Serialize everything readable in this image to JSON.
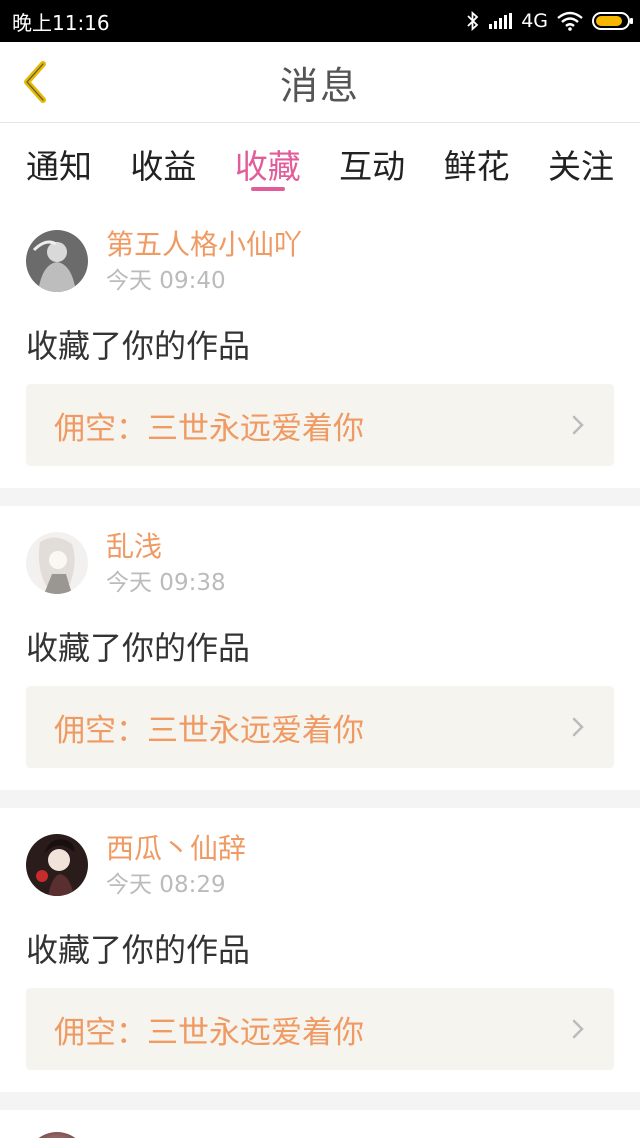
{
  "status_bar": {
    "time": "晚上11:16",
    "network": "4G",
    "battery_percent": 85
  },
  "header": {
    "title": "消息"
  },
  "tabs": [
    {
      "label": "通知",
      "active": false
    },
    {
      "label": "收益",
      "active": false
    },
    {
      "label": "收藏",
      "active": true
    },
    {
      "label": "互动",
      "active": false
    },
    {
      "label": "鲜花",
      "active": false
    },
    {
      "label": "关注",
      "active": false
    }
  ],
  "messages": [
    {
      "username": "第五人格小仙吖",
      "time": "今天 09:40",
      "action": "收藏了你的作品",
      "work_title": "佣空：三世永远爱着你"
    },
    {
      "username": "乱浅",
      "time": "今天 09:38",
      "action": "收藏了你的作品",
      "work_title": "佣空：三世永远爱着你"
    },
    {
      "username": "西瓜丶仙辞",
      "time": "今天 08:29",
      "action": "收藏了你的作品",
      "work_title": "佣空：三世永远爱着你"
    }
  ],
  "colors": {
    "accent_pink": "#e25c9a",
    "accent_orange": "#f09a63",
    "back_arrow": "#e6b800"
  },
  "icons": {
    "back": "chevron-left-icon",
    "more": "chevron-right-icon"
  }
}
